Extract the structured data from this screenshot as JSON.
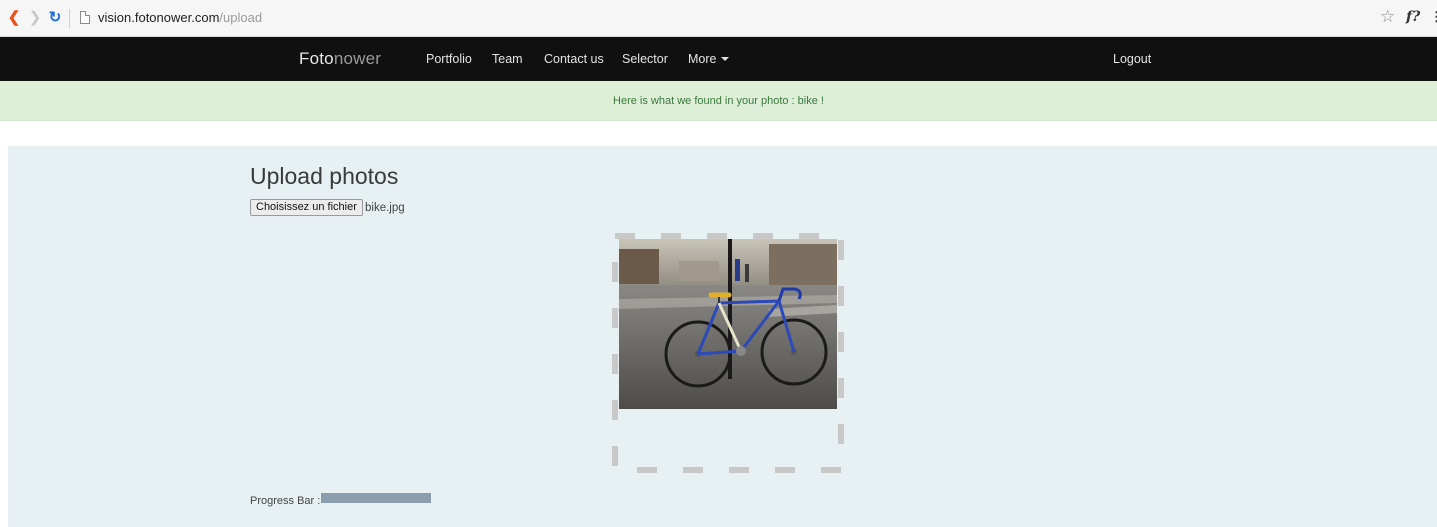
{
  "browser": {
    "url_host": "vision.fotonower.com",
    "url_path": "/upload",
    "menu_glyph": "⋮",
    "ext_label": "f?"
  },
  "navbar": {
    "brand_part1": "Foto",
    "brand_part2": "nower",
    "items": [
      {
        "label": "Portfolio"
      },
      {
        "label": "Team"
      },
      {
        "label": "Contact us"
      },
      {
        "label": "Selector"
      },
      {
        "label": "More"
      }
    ],
    "logout_label": "Logout"
  },
  "alert": {
    "message": "Here is what we found in your photo : bike !"
  },
  "upload": {
    "title": "Upload photos",
    "file_button_label": "Choisissez un fichier",
    "file_name": "bike.jpg"
  },
  "progress": {
    "label": "Progress Bar :",
    "fraction": 1.0
  },
  "colors": {
    "navbar_bg": "#101010",
    "alert_bg": "#deefd8",
    "alert_text": "#3c7a3c",
    "main_bg": "#e7f0f2",
    "progress_fill": "#8a9eb0"
  },
  "icons": {
    "back": "chevron-left-icon",
    "forward": "chevron-right-icon",
    "reload": "reload-icon",
    "page": "page-icon",
    "bookmark": "star-icon",
    "menu": "kebab-menu-icon",
    "more_caret": "caret-down-icon"
  }
}
